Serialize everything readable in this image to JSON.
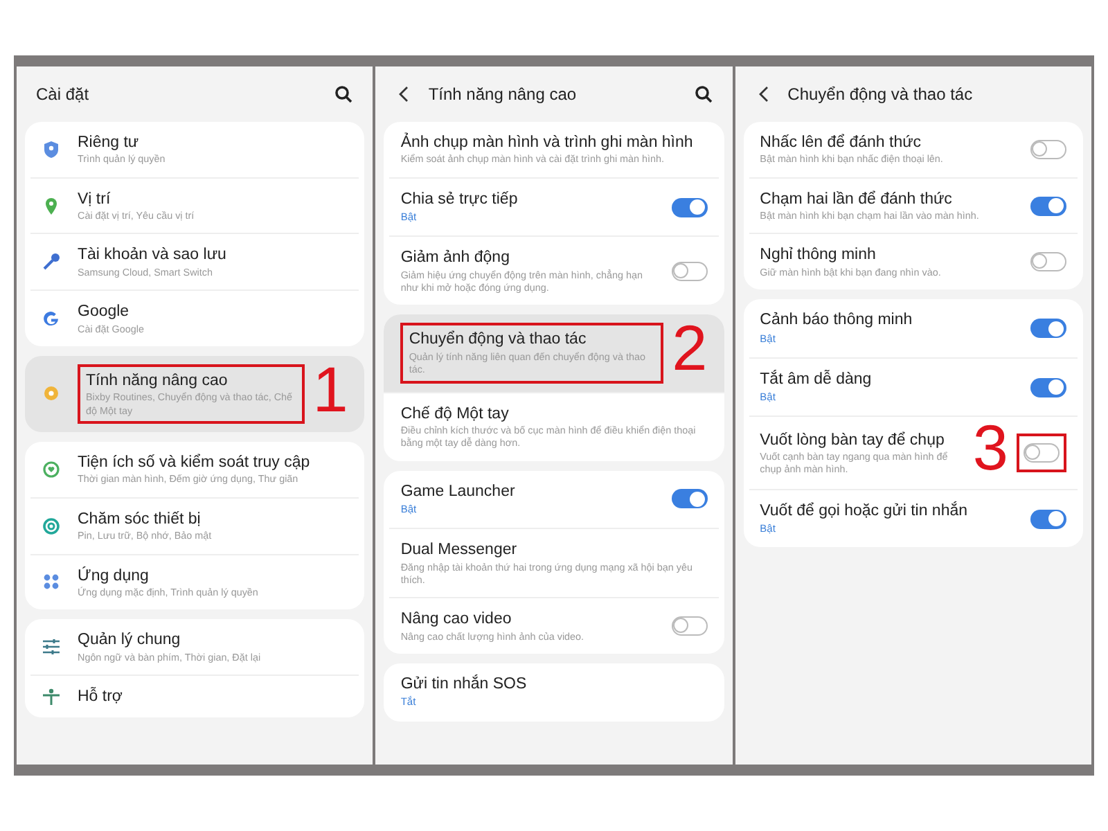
{
  "screens": [
    {
      "title": "Cài đặt",
      "back": false,
      "search": true,
      "step": "1",
      "groups": [
        {
          "items": [
            {
              "title": "Riêng tư",
              "subtitle": "Trình quản lý quyền"
            },
            {
              "title": "Vị trí",
              "subtitle": "Cài đặt vị trí, Yêu cầu vị trí"
            },
            {
              "title": "Tài khoản và sao lưu",
              "subtitle": "Samsung Cloud, Smart Switch"
            },
            {
              "title": "Google",
              "subtitle": "Cài đặt Google"
            }
          ]
        },
        {
          "items": [
            {
              "title": "Tính năng nâng cao",
              "subtitle": "Bixby Routines, Chuyển động và thao tác, Chế độ Một tay",
              "highlighted": true
            }
          ]
        },
        {
          "items": [
            {
              "title": "Tiện ích số và kiểm soát truy cập",
              "subtitle": "Thời gian màn hình, Đếm giờ ứng dụng, Thư giãn"
            },
            {
              "title": "Chăm sóc thiết bị",
              "subtitle": "Pin, Lưu trữ, Bộ nhớ, Bảo mật"
            },
            {
              "title": "Ứng dụng",
              "subtitle": "Ứng dụng mặc định, Trình quản lý quyền"
            }
          ]
        },
        {
          "items": [
            {
              "title": "Quản lý chung",
              "subtitle": "Ngôn ngữ và bàn phím, Thời gian, Đặt lại"
            },
            {
              "title": "Hỗ trợ"
            }
          ]
        }
      ]
    },
    {
      "title": "Tính năng nâng cao",
      "back": true,
      "search": true,
      "step": "2",
      "groups": [
        {
          "items": [
            {
              "title": "Ảnh chụp màn hình và trình ghi màn hình",
              "subtitle": "Kiểm soát ảnh chụp màn hình và cài đặt trình ghi màn hình."
            },
            {
              "title": "Chia sẻ trực tiếp",
              "status": "Bật",
              "on": true
            },
            {
              "title": "Giảm ảnh động",
              "subtitle": "Giảm hiệu ứng chuyển động trên màn hình, chẳng hạn như khi mở hoặc đóng ứng dụng.",
              "on": false
            }
          ]
        },
        {
          "items": [
            {
              "title": "Chuyển động và thao tác",
              "subtitle": "Quản lý tính năng liên quan đến chuyển động và thao tác.",
              "highlighted": true
            },
            {
              "title": "Chế độ Một tay",
              "subtitle": "Điều chỉnh kích thước và bố cục màn hình để điều khiển điện thoại bằng một tay dễ dàng hơn."
            }
          ]
        },
        {
          "items": [
            {
              "title": "Game Launcher",
              "status": "Bật",
              "on": true
            },
            {
              "title": "Dual Messenger",
              "subtitle": "Đăng nhập tài khoản thứ hai trong ứng dụng mạng xã hội bạn yêu thích."
            },
            {
              "title": "Nâng cao video",
              "subtitle": "Nâng cao chất lượng hình ảnh của video.",
              "on": false
            }
          ]
        },
        {
          "items": [
            {
              "title": "Gửi tin nhắn SOS",
              "status": "Tắt"
            }
          ]
        }
      ]
    },
    {
      "title": "Chuyển động và thao tác",
      "back": true,
      "search": false,
      "step": "3",
      "groups": [
        {
          "items": [
            {
              "title": "Nhấc lên để đánh thức",
              "subtitle": "Bật màn hình khi bạn nhấc điện thoại lên.",
              "on": false
            },
            {
              "title": "Chạm hai lần để đánh thức",
              "subtitle": "Bật màn hình khi bạn chạm hai lần vào màn hình.",
              "on": true
            },
            {
              "title": "Nghỉ thông minh",
              "subtitle": "Giữ màn hình bật khi bạn đang nhìn vào.",
              "on": false
            }
          ]
        },
        {
          "items": [
            {
              "title": "Cảnh báo thông minh",
              "status": "Bật",
              "on": true
            },
            {
              "title": "Tắt âm dễ dàng",
              "status": "Bật",
              "on": true
            },
            {
              "title": "Vuốt lòng bàn tay để chụp",
              "subtitle": "Vuốt cạnh bàn tay ngang qua màn hình để chụp ảnh màn hình.",
              "on": false,
              "toggle_highlighted": true
            },
            {
              "title": "Vuốt để gọi hoặc gửi tin nhắn",
              "status": "Bật",
              "on": true
            }
          ]
        }
      ]
    }
  ]
}
